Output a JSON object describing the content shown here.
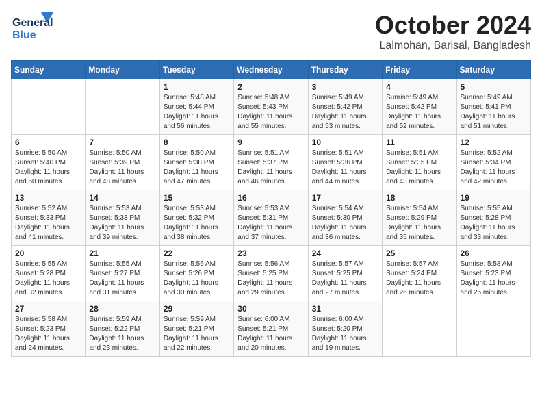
{
  "header": {
    "logo": {
      "general": "General",
      "blue": "Blue"
    },
    "title": "October 2024",
    "location": "Lalmohan, Barisal, Bangladesh"
  },
  "calendar": {
    "days_of_week": [
      "Sunday",
      "Monday",
      "Tuesday",
      "Wednesday",
      "Thursday",
      "Friday",
      "Saturday"
    ],
    "weeks": [
      [
        {
          "day": "",
          "info": ""
        },
        {
          "day": "",
          "info": ""
        },
        {
          "day": "1",
          "info": "Sunrise: 5:48 AM\nSunset: 5:44 PM\nDaylight: 11 hours\nand 56 minutes."
        },
        {
          "day": "2",
          "info": "Sunrise: 5:48 AM\nSunset: 5:43 PM\nDaylight: 11 hours\nand 55 minutes."
        },
        {
          "day": "3",
          "info": "Sunrise: 5:49 AM\nSunset: 5:42 PM\nDaylight: 11 hours\nand 53 minutes."
        },
        {
          "day": "4",
          "info": "Sunrise: 5:49 AM\nSunset: 5:42 PM\nDaylight: 11 hours\nand 52 minutes."
        },
        {
          "day": "5",
          "info": "Sunrise: 5:49 AM\nSunset: 5:41 PM\nDaylight: 11 hours\nand 51 minutes."
        }
      ],
      [
        {
          "day": "6",
          "info": "Sunrise: 5:50 AM\nSunset: 5:40 PM\nDaylight: 11 hours\nand 50 minutes."
        },
        {
          "day": "7",
          "info": "Sunrise: 5:50 AM\nSunset: 5:39 PM\nDaylight: 11 hours\nand 48 minutes."
        },
        {
          "day": "8",
          "info": "Sunrise: 5:50 AM\nSunset: 5:38 PM\nDaylight: 11 hours\nand 47 minutes."
        },
        {
          "day": "9",
          "info": "Sunrise: 5:51 AM\nSunset: 5:37 PM\nDaylight: 11 hours\nand 46 minutes."
        },
        {
          "day": "10",
          "info": "Sunrise: 5:51 AM\nSunset: 5:36 PM\nDaylight: 11 hours\nand 44 minutes."
        },
        {
          "day": "11",
          "info": "Sunrise: 5:51 AM\nSunset: 5:35 PM\nDaylight: 11 hours\nand 43 minutes."
        },
        {
          "day": "12",
          "info": "Sunrise: 5:52 AM\nSunset: 5:34 PM\nDaylight: 11 hours\nand 42 minutes."
        }
      ],
      [
        {
          "day": "13",
          "info": "Sunrise: 5:52 AM\nSunset: 5:33 PM\nDaylight: 11 hours\nand 41 minutes."
        },
        {
          "day": "14",
          "info": "Sunrise: 5:53 AM\nSunset: 5:33 PM\nDaylight: 11 hours\nand 39 minutes."
        },
        {
          "day": "15",
          "info": "Sunrise: 5:53 AM\nSunset: 5:32 PM\nDaylight: 11 hours\nand 38 minutes."
        },
        {
          "day": "16",
          "info": "Sunrise: 5:53 AM\nSunset: 5:31 PM\nDaylight: 11 hours\nand 37 minutes."
        },
        {
          "day": "17",
          "info": "Sunrise: 5:54 AM\nSunset: 5:30 PM\nDaylight: 11 hours\nand 36 minutes."
        },
        {
          "day": "18",
          "info": "Sunrise: 5:54 AM\nSunset: 5:29 PM\nDaylight: 11 hours\nand 35 minutes."
        },
        {
          "day": "19",
          "info": "Sunrise: 5:55 AM\nSunset: 5:28 PM\nDaylight: 11 hours\nand 33 minutes."
        }
      ],
      [
        {
          "day": "20",
          "info": "Sunrise: 5:55 AM\nSunset: 5:28 PM\nDaylight: 11 hours\nand 32 minutes."
        },
        {
          "day": "21",
          "info": "Sunrise: 5:55 AM\nSunset: 5:27 PM\nDaylight: 11 hours\nand 31 minutes."
        },
        {
          "day": "22",
          "info": "Sunrise: 5:56 AM\nSunset: 5:26 PM\nDaylight: 11 hours\nand 30 minutes."
        },
        {
          "day": "23",
          "info": "Sunrise: 5:56 AM\nSunset: 5:25 PM\nDaylight: 11 hours\nand 29 minutes."
        },
        {
          "day": "24",
          "info": "Sunrise: 5:57 AM\nSunset: 5:25 PM\nDaylight: 11 hours\nand 27 minutes."
        },
        {
          "day": "25",
          "info": "Sunrise: 5:57 AM\nSunset: 5:24 PM\nDaylight: 11 hours\nand 26 minutes."
        },
        {
          "day": "26",
          "info": "Sunrise: 5:58 AM\nSunset: 5:23 PM\nDaylight: 11 hours\nand 25 minutes."
        }
      ],
      [
        {
          "day": "27",
          "info": "Sunrise: 5:58 AM\nSunset: 5:23 PM\nDaylight: 11 hours\nand 24 minutes."
        },
        {
          "day": "28",
          "info": "Sunrise: 5:59 AM\nSunset: 5:22 PM\nDaylight: 11 hours\nand 23 minutes."
        },
        {
          "day": "29",
          "info": "Sunrise: 5:59 AM\nSunset: 5:21 PM\nDaylight: 11 hours\nand 22 minutes."
        },
        {
          "day": "30",
          "info": "Sunrise: 6:00 AM\nSunset: 5:21 PM\nDaylight: 11 hours\nand 20 minutes."
        },
        {
          "day": "31",
          "info": "Sunrise: 6:00 AM\nSunset: 5:20 PM\nDaylight: 11 hours\nand 19 minutes."
        },
        {
          "day": "",
          "info": ""
        },
        {
          "day": "",
          "info": ""
        }
      ]
    ]
  }
}
